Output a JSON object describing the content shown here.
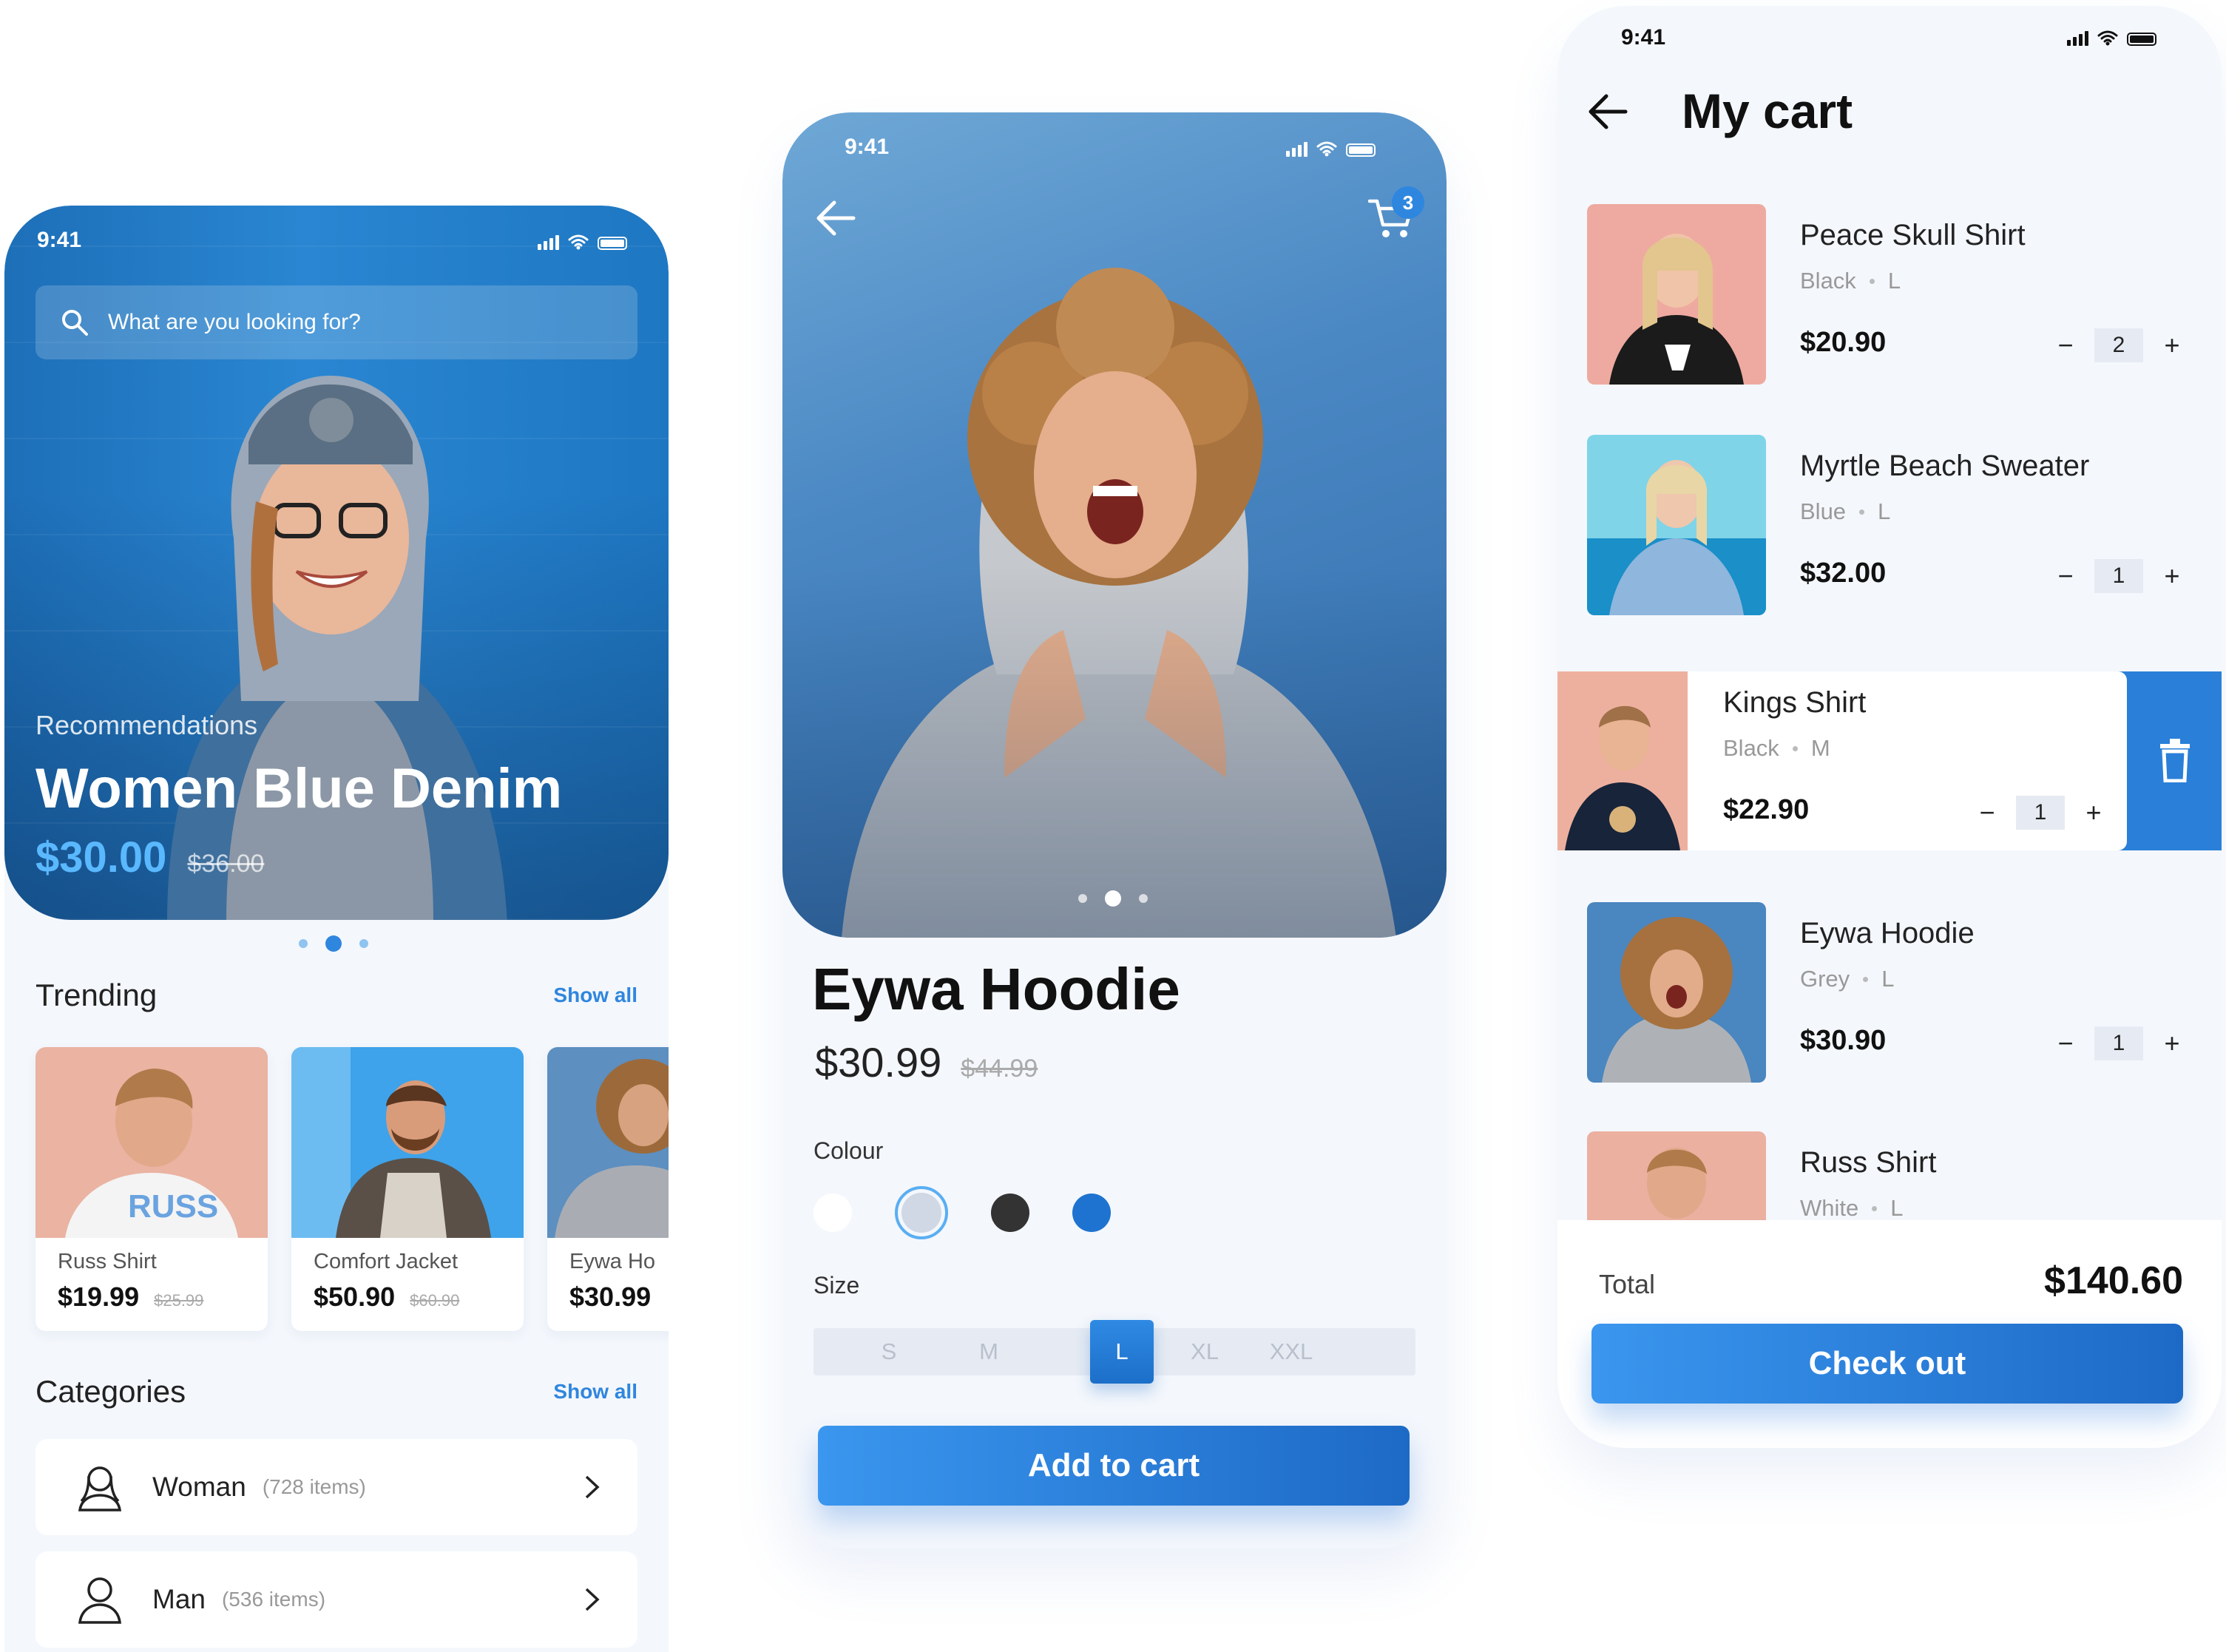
{
  "status": {
    "time": "9:41"
  },
  "home": {
    "search_placeholder": "What are you looking for?",
    "hero": {
      "label": "Recommendations",
      "title": "Women Blue Denim",
      "price": "$30.00",
      "old_price": "$36.00",
      "slide_active": 2,
      "slide_count": 3
    },
    "trending": {
      "title": "Trending",
      "show_all": "Show all",
      "items": [
        {
          "name": "Russ Shirt",
          "price": "$19.99",
          "old_price": "$25.99"
        },
        {
          "name": "Comfort Jacket",
          "price": "$50.90",
          "old_price": "$60.90"
        },
        {
          "name": "Eywa Ho",
          "price": "$30.99",
          "old_price": ""
        }
      ]
    },
    "categories": {
      "title": "Categories",
      "show_all": "Show all",
      "items": [
        {
          "label": "Woman",
          "count": "(728 items)",
          "icon": "woman-icon"
        },
        {
          "label": "Man",
          "count": "(536 items)",
          "icon": "man-icon"
        }
      ]
    }
  },
  "product": {
    "cart_count": "3",
    "title": "Eywa Hoodie",
    "price": "$30.99",
    "old_price": "$44.99",
    "colour_label": "Colour",
    "colours": [
      "#ffffff",
      "#d1d9e4",
      "#333333",
      "#1e73d0"
    ],
    "selected_colour": 1,
    "size_label": "Size",
    "sizes": [
      "S",
      "M",
      "L",
      "XL",
      "XXL"
    ],
    "selected_size": "L",
    "add_to_cart": "Add to cart",
    "slide_active": 2,
    "slide_count": 3
  },
  "cart": {
    "title": "My cart",
    "items": [
      {
        "name": "Peace Skull Shirt",
        "color": "Black",
        "size": "L",
        "price": "$20.90",
        "qty": "2"
      },
      {
        "name": "Myrtle Beach Sweater",
        "color": "Blue",
        "size": "L",
        "price": "$32.00",
        "qty": "1"
      },
      {
        "name": "Kings Shirt",
        "color": "Black",
        "size": "M",
        "price": "$22.90",
        "qty": "1"
      },
      {
        "name": "Eywa Hoodie",
        "color": "Grey",
        "size": "L",
        "price": "$30.90",
        "qty": "1"
      },
      {
        "name": "Russ Shirt",
        "color": "White",
        "size": "L",
        "price": "",
        "qty": ""
      }
    ],
    "qty_minus": "−",
    "qty_plus": "+",
    "total_label": "Total",
    "total_value": "$140.60",
    "checkout": "Check out"
  },
  "colors": {
    "accent": "#2f86de",
    "accent_dark": "#1d6ac6",
    "background": "#f4f7fc"
  }
}
